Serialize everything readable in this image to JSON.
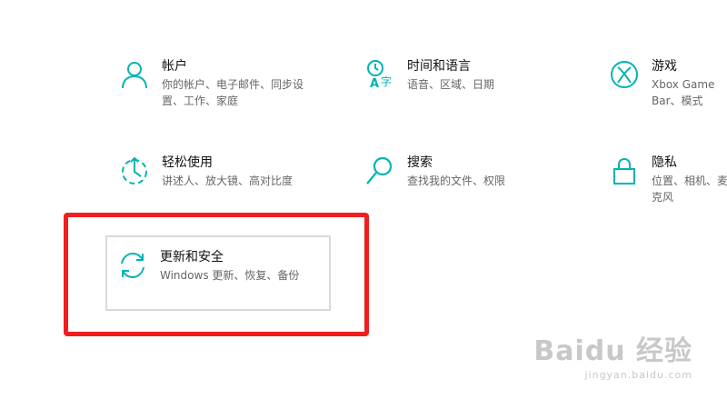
{
  "accent_color": "#00b4b4",
  "highlight_color": "#f21d1d",
  "settings": [
    {
      "icon": "person-icon",
      "title": "帐户",
      "desc": "你的帐户、电子邮件、同步设置、工作、家庭"
    },
    {
      "icon": "time-language-icon",
      "title": "时间和语言",
      "desc": "语音、区域、日期"
    },
    {
      "icon": "xbox-icon",
      "title": "游戏",
      "desc": "Xbox Game Bar、模式"
    },
    {
      "icon": "ease-of-access-icon",
      "title": "轻松使用",
      "desc": "讲述人、放大镜、高对比度"
    },
    {
      "icon": "search-icon",
      "title": "搜索",
      "desc": "查找我的文件、权限"
    },
    {
      "icon": "lock-icon",
      "title": "隐私",
      "desc": "位置、相机、麦克风"
    },
    {
      "icon": "sync-icon",
      "title": "更新和安全",
      "desc": "Windows 更新、恢复、备份"
    }
  ],
  "watermark": {
    "brand": "Baidu 经验",
    "url": "jingyan.baidu.com"
  }
}
